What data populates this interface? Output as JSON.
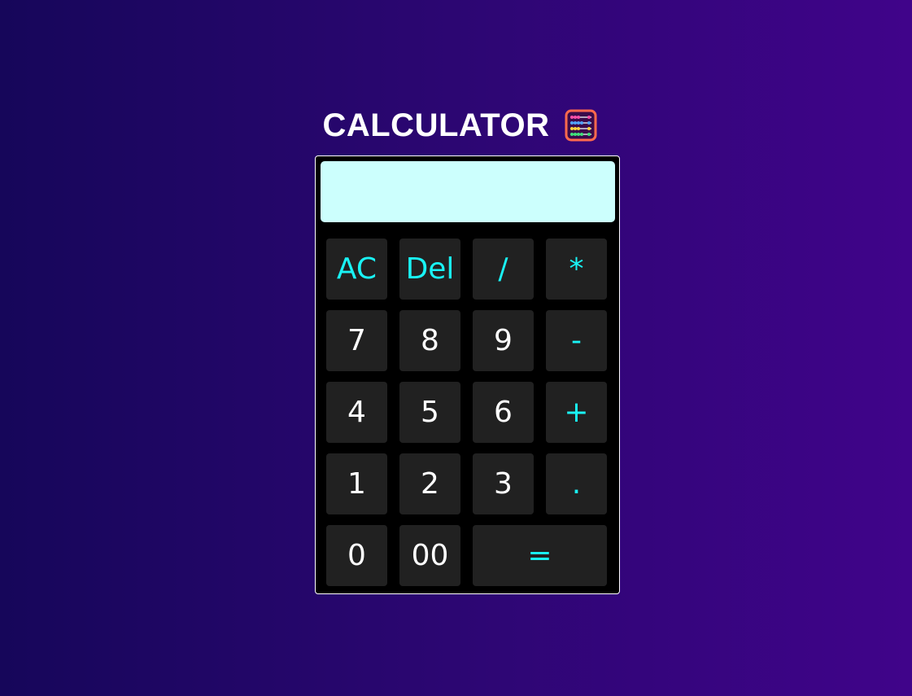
{
  "app": {
    "title": "CALCULATOR",
    "title_icon": "abacus-icon"
  },
  "display": {
    "value": ""
  },
  "keys": [
    {
      "label": "AC",
      "type": "operator"
    },
    {
      "label": "Del",
      "type": "operator"
    },
    {
      "label": "/",
      "type": "operator"
    },
    {
      "label": "*",
      "type": "operator"
    },
    {
      "label": "7",
      "type": "digit"
    },
    {
      "label": "8",
      "type": "digit"
    },
    {
      "label": "9",
      "type": "digit"
    },
    {
      "label": "-",
      "type": "operator"
    },
    {
      "label": "4",
      "type": "digit"
    },
    {
      "label": "5",
      "type": "digit"
    },
    {
      "label": "6",
      "type": "digit"
    },
    {
      "label": "+",
      "type": "operator"
    },
    {
      "label": "1",
      "type": "digit"
    },
    {
      "label": "2",
      "type": "digit"
    },
    {
      "label": "3",
      "type": "digit"
    },
    {
      "label": ".",
      "type": "operator"
    },
    {
      "label": "0",
      "type": "digit"
    },
    {
      "label": "00",
      "type": "digit"
    },
    {
      "label": "=",
      "type": "operator"
    }
  ],
  "colors": {
    "background_start": "#16065a",
    "background_end": "#40048a",
    "calculator_body": "#000000",
    "display_background": "#ccfffd",
    "key_background": "#212121",
    "digit_text": "#ffffff",
    "operator_text": "#19f3f5"
  }
}
